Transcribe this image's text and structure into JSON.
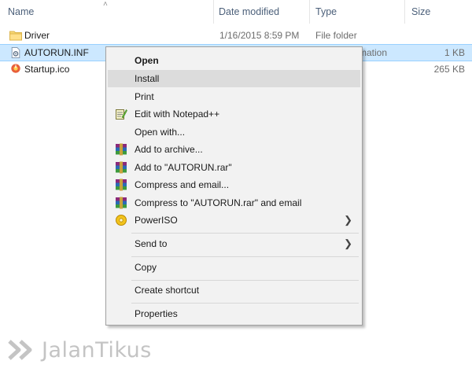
{
  "header": {
    "columns": [
      {
        "label": "Name"
      },
      {
        "label": "Date modified"
      },
      {
        "label": "Type"
      },
      {
        "label": "Size"
      }
    ]
  },
  "files": [
    {
      "name": "Driver",
      "date": "1/16/2015 8:59 PM",
      "type": "File folder",
      "size": "",
      "icon": "folder-icon"
    },
    {
      "name": "AUTORUN.INF",
      "date": "",
      "type": "rmation",
      "size": "1 KB",
      "icon": "settings-file-icon",
      "selected": true
    },
    {
      "name": "Startup.ico",
      "date": "",
      "type": "",
      "size": "265 KB",
      "icon": "ico-file-icon"
    }
  ],
  "context_menu": {
    "items": [
      {
        "label": "Open",
        "bold": true
      },
      {
        "label": "Install",
        "highlighted": true
      },
      {
        "label": "Print"
      },
      {
        "label": "Edit with Notepad++",
        "icon": "notepad-plus-plus-icon"
      },
      {
        "label": "Open with..."
      },
      {
        "label": "Add to archive...",
        "icon": "winrar-icon"
      },
      {
        "label": "Add to \"AUTORUN.rar\"",
        "icon": "winrar-icon"
      },
      {
        "label": "Compress and email...",
        "icon": "winrar-icon"
      },
      {
        "label": "Compress to \"AUTORUN.rar\" and email",
        "icon": "winrar-icon"
      },
      {
        "label": "PowerISO",
        "icon": "poweriso-icon",
        "submenu": true
      },
      {
        "label": "Send to",
        "submenu": true
      },
      {
        "label": "Copy"
      },
      {
        "label": "Create shortcut"
      },
      {
        "label": "Properties"
      }
    ]
  },
  "watermark": {
    "text": "JalanTikus"
  },
  "colors": {
    "selection": "#cce8ff",
    "menu_bg": "#f2f2f2",
    "menu_highlight": "#dcdcdc",
    "header_text": "#4c607a"
  }
}
